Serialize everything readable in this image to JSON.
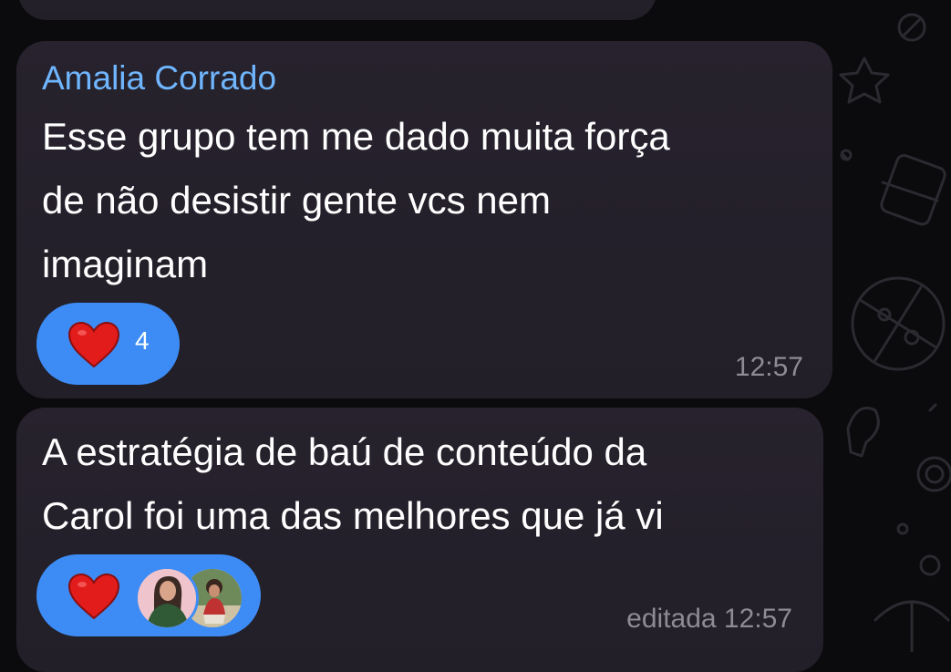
{
  "messages": [
    {
      "sender": "Amalia Corrado",
      "lines": [
        "Esse grupo tem me dado muita força",
        "de não desistir gente vcs nem",
        "imaginam"
      ],
      "reaction": {
        "emoji": "heart",
        "count": "4"
      },
      "time": "12:57"
    },
    {
      "lines": [
        "A estratégia de baú de conteúdo da",
        "Carol foi uma das melhores que já vi"
      ],
      "reaction": {
        "emoji": "heart",
        "avatars": [
          "avatar-woman-green",
          "avatar-woman-outdoors"
        ]
      },
      "time": "editada 12:57"
    }
  ],
  "colors": {
    "background": "#0b0b0e",
    "bubble": "#26222c",
    "sender": "#6fb6ff",
    "reaction": "#3d8cf5",
    "heart": "#e21b1b",
    "time": "#8e8b96"
  }
}
